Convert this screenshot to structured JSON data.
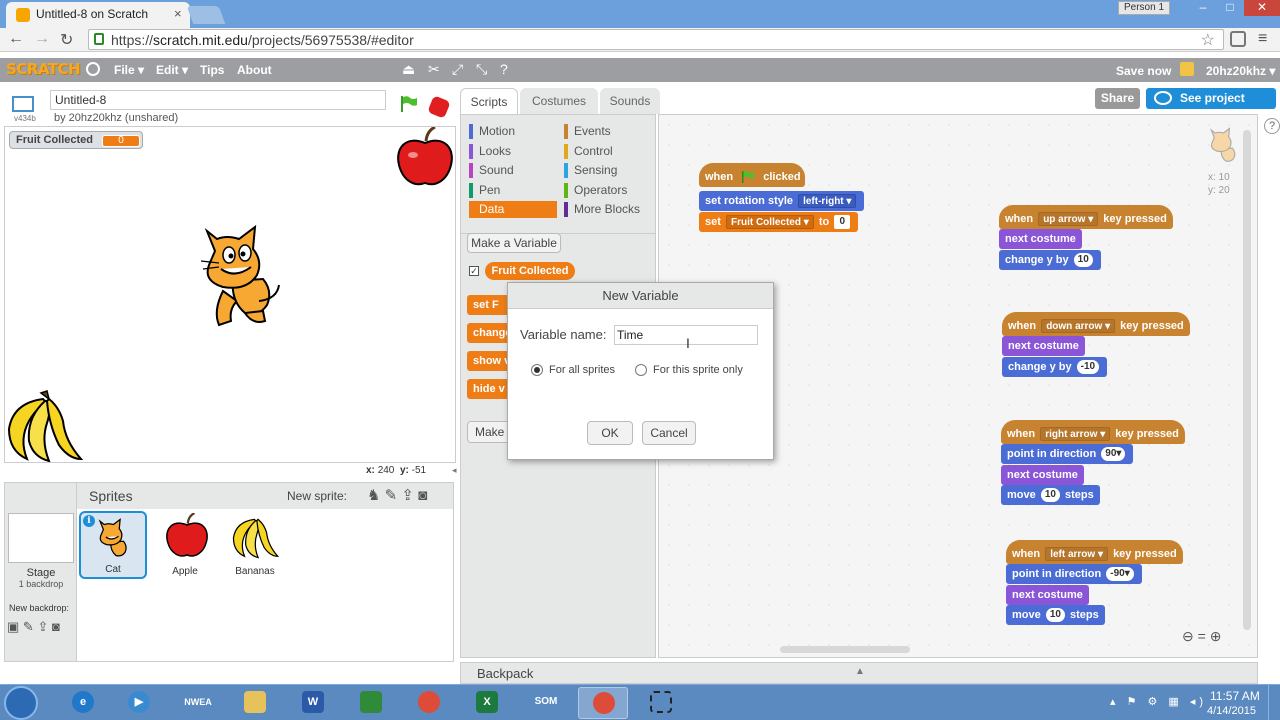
{
  "browser": {
    "tab_title": "Untitled-8 on Scratch",
    "tab_close": "×",
    "profile": "Person 1",
    "url_scheme": "https://",
    "url_host": "scratch.mit.edu",
    "url_path": "/projects/56975538/#editor",
    "win_min": "–",
    "win_max": "□",
    "win_close": "✕"
  },
  "menubar": {
    "logo": "SCRATCH",
    "file": "File ▾",
    "edit": "Edit ▾",
    "tips": "Tips",
    "about": "About",
    "save_now": "Save now",
    "user": "20hz20khz ▾"
  },
  "project": {
    "title": "Untitled-8",
    "owner": "by 20hz20khz (unshared)",
    "version": "v434b"
  },
  "stage": {
    "monitor_label": "Fruit Collected",
    "monitor_value": "0",
    "x_label": "x:",
    "x_value": "240",
    "y_label": "y:",
    "y_value": "-51"
  },
  "sprites_pane": {
    "stage_label": "Stage",
    "backdrop_count": "1 backdrop",
    "new_backdrop": "New backdrop:",
    "sprites_label": "Sprites",
    "new_sprite": "New sprite:",
    "info": "i",
    "sprites": [
      {
        "name": "Cat"
      },
      {
        "name": "Apple"
      },
      {
        "name": "Bananas"
      }
    ]
  },
  "tabs": {
    "scripts": "Scripts",
    "costumes": "Costumes",
    "sounds": "Sounds"
  },
  "palette": {
    "categories": [
      {
        "label": "Motion",
        "color": "#4a6cd4"
      },
      {
        "label": "Looks",
        "color": "#8a55d7"
      },
      {
        "label": "Sound",
        "color": "#bb42c3"
      },
      {
        "label": "Pen",
        "color": "#0e9a6c"
      },
      {
        "label": "Data",
        "color": "#ee7d16"
      },
      {
        "label": "Events",
        "color": "#c88330"
      },
      {
        "label": "Control",
        "color": "#e1a91a"
      },
      {
        "label": "Sensing",
        "color": "#2ca5e2"
      },
      {
        "label": "Operators",
        "color": "#5cb712"
      },
      {
        "label": "More Blocks",
        "color": "#632d99"
      }
    ],
    "make_variable": "Make a Variable",
    "variable": "Fruit Collected",
    "block_set": "set F",
    "block_change": "change",
    "block_show": "show v",
    "block_hide": "hide v",
    "make_list": "Make a"
  },
  "header_buttons": {
    "share": "Share",
    "see_project": "See project page"
  },
  "script_area": {
    "sprite_x": "x: 10",
    "sprite_y": "y: 20",
    "script1": {
      "hat_when": "when",
      "hat_clicked": "clicked",
      "rot_label": "set rotation style",
      "rot_value": "left-right ▾",
      "set_label": "set",
      "set_var": "Fruit Collected ▾",
      "set_to": "to",
      "set_value": "0"
    },
    "script2": {
      "when": "when",
      "key": "up arrow ▾",
      "pressed": "key pressed",
      "b1": "next costume",
      "b2_label": "change y by",
      "b2_value": "10"
    },
    "script3": {
      "when": "when",
      "key": "down arrow ▾",
      "pressed": "key pressed",
      "b1": "next costume",
      "b2_label": "change y by",
      "b2_value": "-10"
    },
    "script4": {
      "when": "when",
      "key": "right arrow ▾",
      "pressed": "key pressed",
      "b1_label": "point in direction",
      "b1_value": "90▾",
      "b2": "next costume",
      "b3_label": "move",
      "b3_value": "10",
      "b3_end": "steps"
    },
    "script5": {
      "when": "when",
      "key": "left arrow ▾",
      "pressed": "key pressed",
      "b1_label": "point in direction",
      "b1_value": "-90▾",
      "b2": "next costume",
      "b3_label": "move",
      "b3_value": "10",
      "b3_end": "steps"
    }
  },
  "dialog": {
    "title": "New Variable",
    "name_label": "Variable name:",
    "name_value": "Time",
    "for_all": "For all sprites",
    "for_this": "For this sprite only",
    "ok": "OK",
    "cancel": "Cancel"
  },
  "backpack": {
    "label": "Backpack",
    "arrow": "▲"
  },
  "taskbar": {
    "time": "11:57 AM",
    "date": "4/14/2015",
    "nwea": "NWEA",
    "word": "W",
    "excel": "X",
    "som": "SOM"
  }
}
